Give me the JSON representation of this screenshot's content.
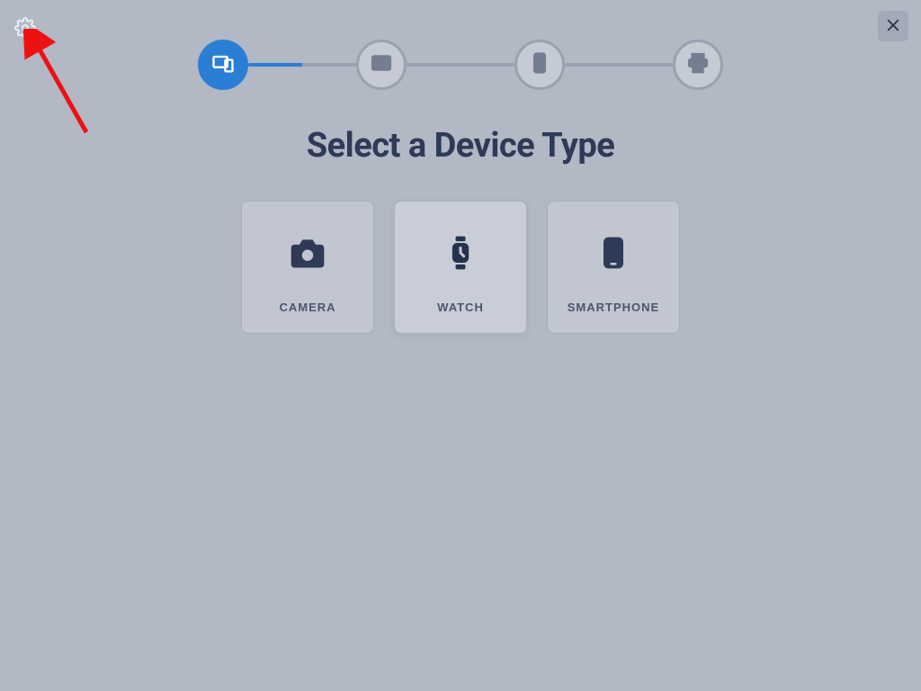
{
  "title": "Select a Device Type",
  "stepper": {
    "steps": [
      {
        "key": "device-type",
        "active": true
      },
      {
        "key": "basic-info",
        "active": false
      },
      {
        "key": "device-data",
        "active": false
      },
      {
        "key": "label",
        "active": false
      }
    ]
  },
  "devices": [
    {
      "key": "camera",
      "label": "CAMERA"
    },
    {
      "key": "watch",
      "label": "WATCH"
    },
    {
      "key": "smartphone",
      "label": "SMARTPHONE"
    }
  ],
  "colors": {
    "accent": "#2a7fd5",
    "text_dark": "#2e3a56",
    "page_bg": "#b2b8c4"
  }
}
